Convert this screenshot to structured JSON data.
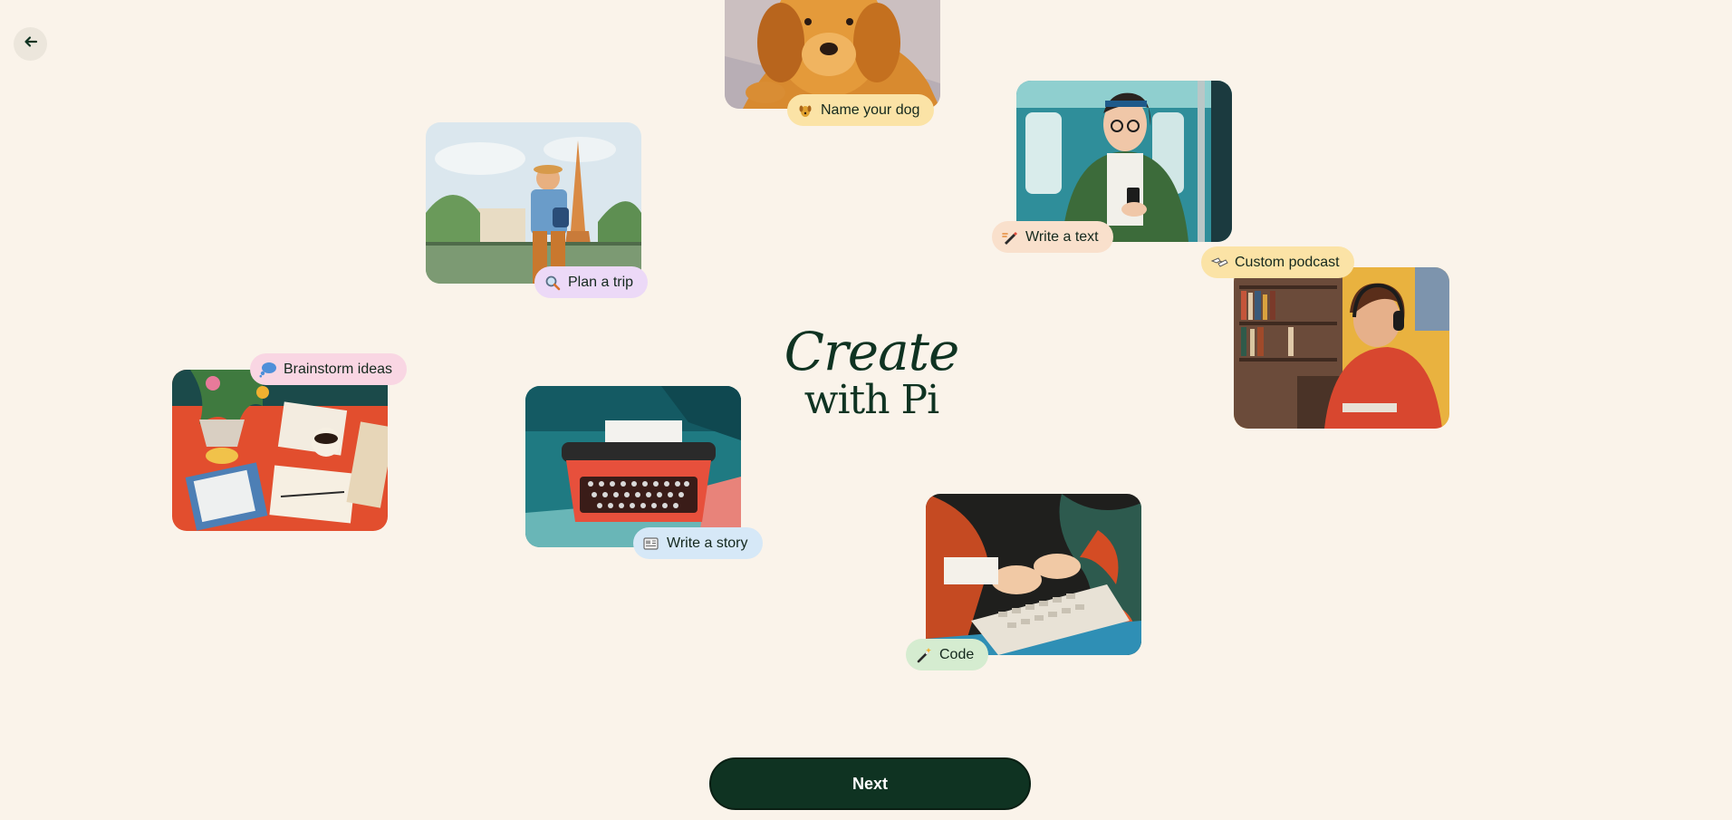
{
  "nav": {
    "back_icon": "arrow-left-icon"
  },
  "hero": {
    "title_line1": "Create",
    "title_line2": "with Pi"
  },
  "cards": [
    {
      "label": "Name your dog",
      "icon": "dog-icon",
      "chip_color": "#fbe3a6",
      "image": "golden retriever lying on blanket"
    },
    {
      "label": "Plan a trip",
      "icon": "magnifier-icon",
      "chip_color": "#ecd9f7",
      "image": "traveler looking at Eiffel Tower"
    },
    {
      "label": "Write a text",
      "icon": "pen-icon",
      "chip_color": "#f9e0cc",
      "image": "woman on train reading phone"
    },
    {
      "label": "Custom podcast",
      "icon": "headphones-icon",
      "chip_color": "#fbe3a6",
      "image": "young man with headphones in library"
    },
    {
      "label": "Brainstorm ideas",
      "icon": "thought-bubble-icon",
      "chip_color": "#f9d6e3",
      "image": "desk with papers, plant and coffee"
    },
    {
      "label": "Write a story",
      "icon": "newspaper-icon",
      "chip_color": "#d6e8f7",
      "image": "red typewriter on teal table"
    },
    {
      "label": "Code",
      "icon": "magic-wand-icon",
      "chip_color": "#d5ecd0",
      "image": "hands typing on keyboard"
    }
  ],
  "footer": {
    "next_label": "Next"
  },
  "colors": {
    "background": "#faf3ea",
    "primary": "#0f3322",
    "back_button_bg": "#ece6dc"
  }
}
